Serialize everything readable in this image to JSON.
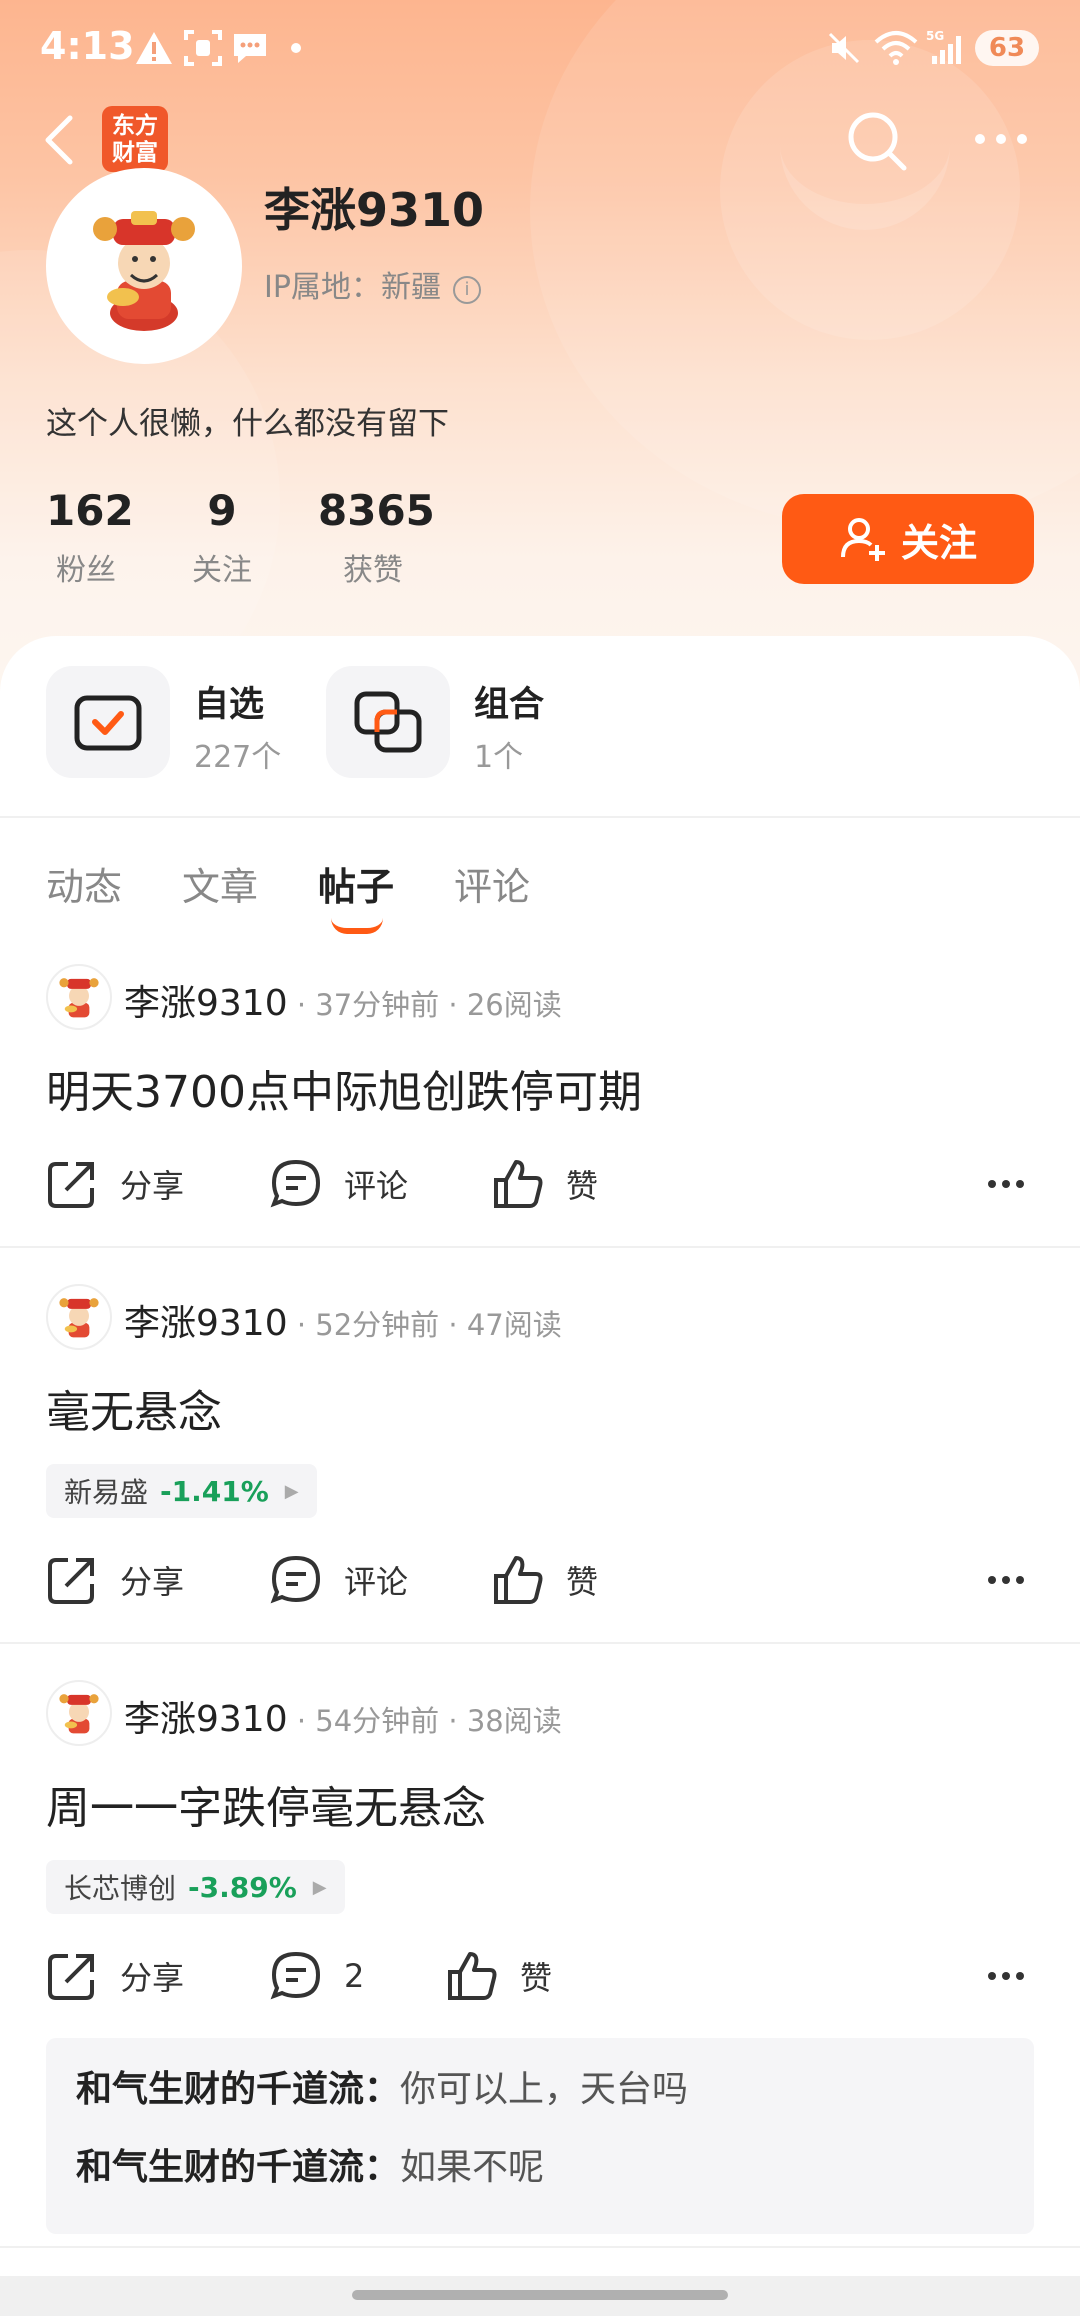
{
  "status": {
    "time": "4:13",
    "battery": "63"
  },
  "nav": {
    "logo_line1": "东方",
    "logo_line2": "财富"
  },
  "profile": {
    "name": "李涨9310",
    "ip_label": "IP属地：新疆",
    "bio": "这个人很懒，什么都没有留下",
    "stats": [
      {
        "num": "162",
        "label": "粉丝"
      },
      {
        "num": "9",
        "label": "关注"
      },
      {
        "num": "8365",
        "label": "获赞"
      }
    ],
    "follow_label": "关注"
  },
  "quick": [
    {
      "title": "自选",
      "sub": "227个"
    },
    {
      "title": "组合",
      "sub": "1个"
    }
  ],
  "tabs": [
    "动态",
    "文章",
    "帖子",
    "评论"
  ],
  "active_tab": "帖子",
  "actions": {
    "share": "分享",
    "comment": "评论",
    "like": "赞"
  },
  "posts": [
    {
      "author": "李涨9310",
      "meta": " · 37分钟前 · 26阅读",
      "text": "明天3700点中际旭创跌停可期",
      "comment_label": "评论"
    },
    {
      "author": "李涨9310",
      "meta": " · 52分钟前 · 47阅读",
      "text": "毫无悬念",
      "stock_name": "新易盛",
      "stock_change": "-1.41%",
      "comment_label": "评论"
    },
    {
      "author": "李涨9310",
      "meta": " · 54分钟前 · 38阅读",
      "text": "周一一字跌停毫无悬念",
      "stock_name": "长芯博创",
      "stock_change": "-3.89%",
      "comment_label": "2",
      "comments": [
        {
          "name": "和气生财的千道流：",
          "text": "你可以上，天台吗"
        },
        {
          "name": "和气生财的千道流：",
          "text": "如果不呢"
        }
      ]
    }
  ],
  "colors": {
    "accent": "#ff5a14",
    "down_green": "#19a05a"
  }
}
